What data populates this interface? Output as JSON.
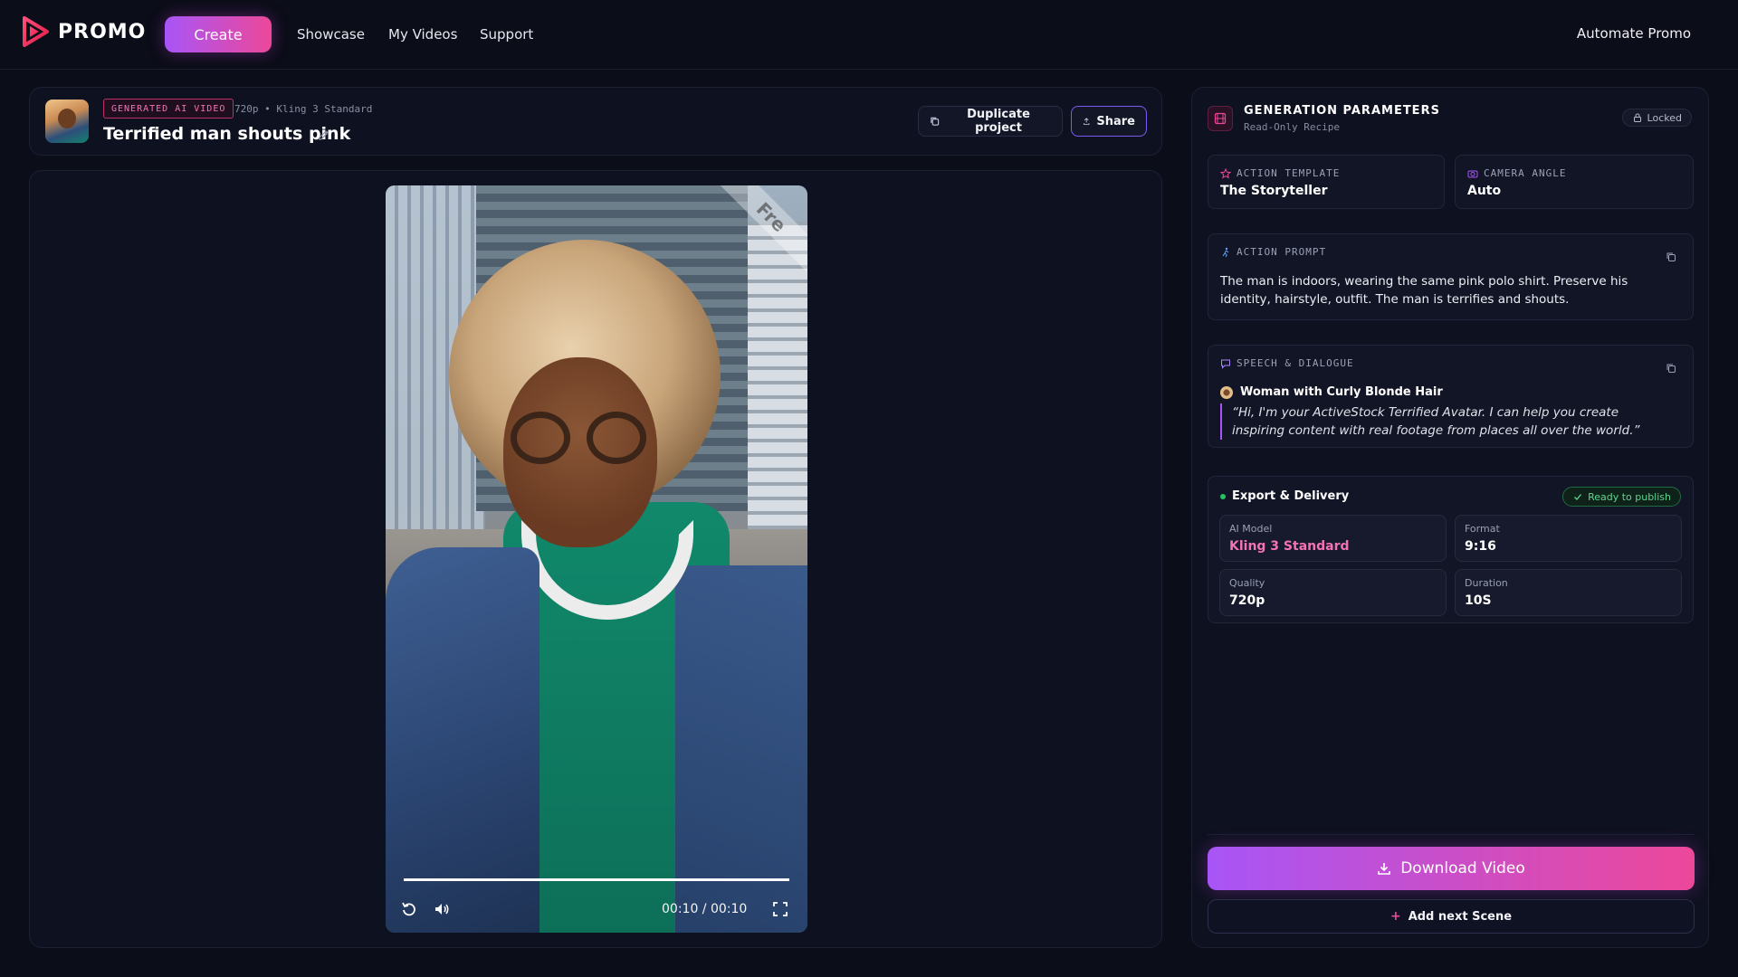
{
  "nav": {
    "logo_text": "PROMO",
    "create_label": "Create",
    "links": [
      "Showcase",
      "My Videos",
      "Support"
    ],
    "automate_label": "Automate Promo"
  },
  "project": {
    "badge": "GENERATED AI VIDEO",
    "meta": "720p • Kling 3 Standard",
    "title": "Terrified man shouts pink",
    "duplicate_label": "Duplicate project",
    "share_label": "Share"
  },
  "player": {
    "watermark": "Fre",
    "time": "00:10 / 00:10",
    "progress": 1.0,
    "icons": [
      "replay-icon",
      "volume-icon",
      "fullscreen-icon"
    ]
  },
  "params": {
    "title": "GENERATION PARAMETERS",
    "subtitle": "Read-Only Recipe",
    "locked_label": "Locked",
    "action_template": {
      "label": "ACTION TEMPLATE",
      "value": "The Storyteller"
    },
    "camera_angle": {
      "label": "CAMERA ANGLE",
      "value": "Auto"
    },
    "action_prompt": {
      "label": "ACTION PROMPT",
      "text": "The man is indoors, wearing the same pink polo shirt. Preserve his identity, hairstyle, outfit. The man is terrifies and shouts."
    },
    "speech": {
      "label": "SPEECH & DIALOGUE",
      "speaker": "Woman with Curly Blonde Hair",
      "quote": "“Hi, I'm your ActiveStock Terrified Avatar. I can help you create inspiring content with real footage from places all over the world.”"
    },
    "export": {
      "title": "Export & Delivery",
      "ready_label": "Ready to publish",
      "items": [
        {
          "label": "AI Model",
          "value": "Kling 3 Standard"
        },
        {
          "label": "Format",
          "value": "9:16"
        },
        {
          "label": "Quality",
          "value": "720p"
        },
        {
          "label": "Duration",
          "value": "10S"
        }
      ]
    },
    "download_label": "Download Video",
    "add_scene_label": "Add next Scene"
  },
  "colors": {
    "accent_start": "#a855f7",
    "accent_end": "#ec4899",
    "background": "#0b0d18",
    "ready_green": "#22c55e"
  }
}
